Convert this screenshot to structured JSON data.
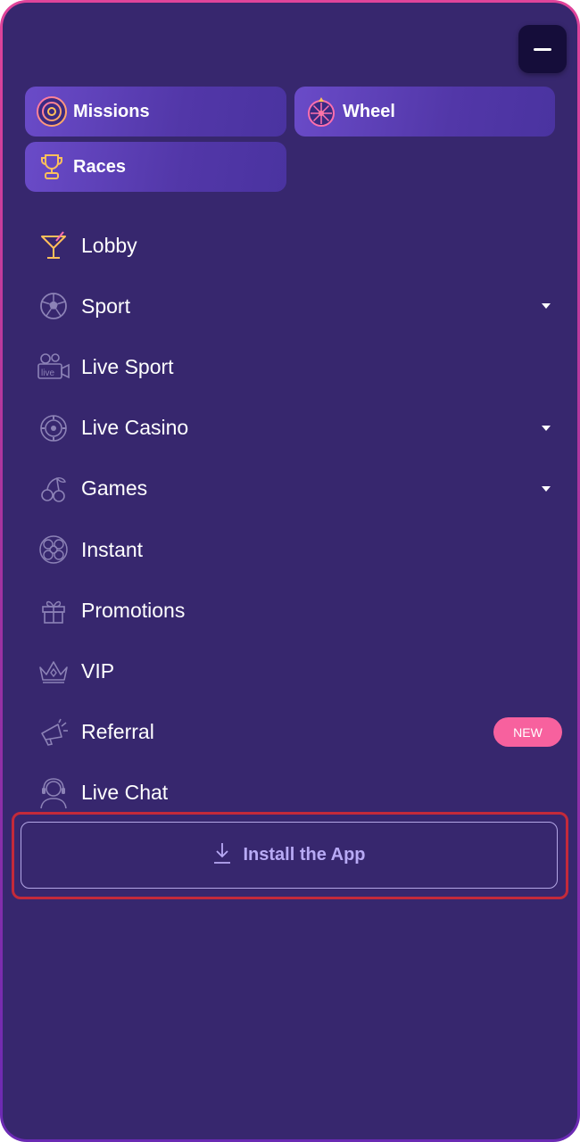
{
  "header": {
    "collapse_label": ""
  },
  "quick_links": [
    {
      "label": "Missions",
      "icon": "target-icon"
    },
    {
      "label": "Wheel",
      "icon": "fortune-wheel-icon"
    },
    {
      "label": "Races",
      "icon": "trophy-icon"
    }
  ],
  "nav": {
    "items": [
      {
        "label": "Lobby",
        "icon": "cocktail-icon",
        "has_dropdown": false
      },
      {
        "label": "Sport",
        "icon": "soccer-ball-icon",
        "has_dropdown": true
      },
      {
        "label": "Live Sport",
        "icon": "live-camera-icon",
        "has_dropdown": false
      },
      {
        "label": "Live Casino",
        "icon": "casino-chip-icon",
        "has_dropdown": true
      },
      {
        "label": "Games",
        "icon": "cherries-icon",
        "has_dropdown": true
      },
      {
        "label": "Instant",
        "icon": "lottery-balls-icon",
        "has_dropdown": false
      },
      {
        "label": "Promotions",
        "icon": "gift-icon",
        "has_dropdown": false
      },
      {
        "label": "VIP",
        "icon": "crown-icon",
        "has_dropdown": false
      },
      {
        "label": "Referral",
        "icon": "megaphone-icon",
        "has_dropdown": false,
        "badge": "NEW"
      },
      {
        "label": "Live Chat",
        "icon": "headset-agent-icon",
        "has_dropdown": false
      }
    ]
  },
  "install": {
    "label": "Install the App",
    "icon": "download-icon"
  },
  "colors": {
    "panel_bg": "#37276e",
    "accent_pink": "#f7619e",
    "install_text": "#b8aaf5",
    "highlight_outline": "#c42a3a"
  }
}
